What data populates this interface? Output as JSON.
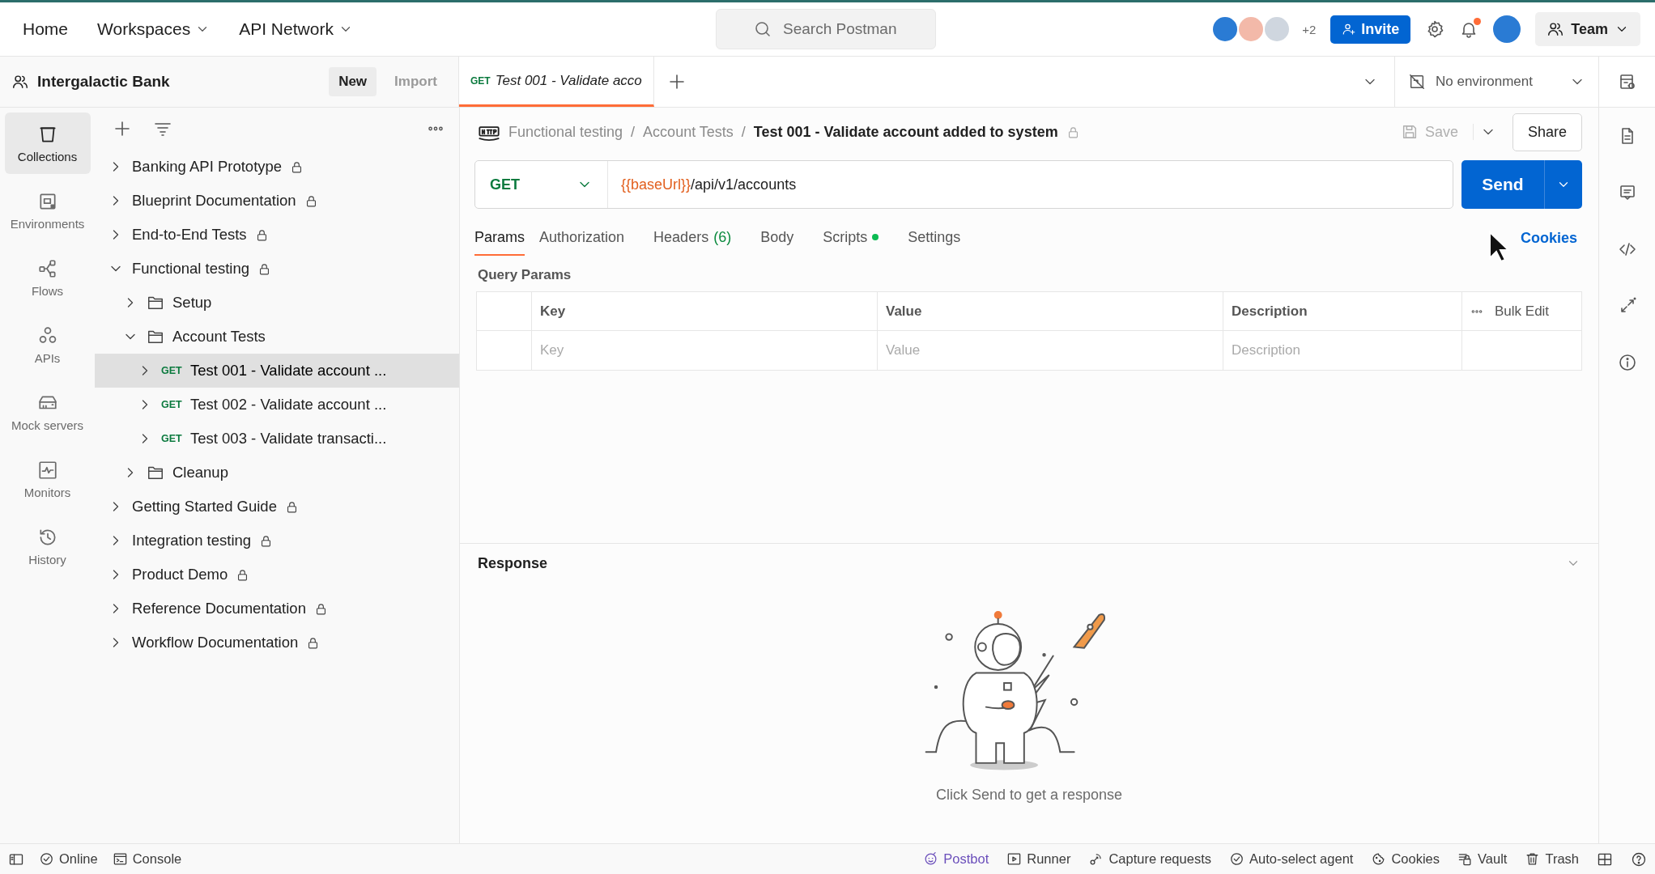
{
  "top_nav": [
    {
      "label": "Home",
      "has_menu": false
    },
    {
      "label": "Workspaces",
      "has_menu": true
    },
    {
      "label": "API Network",
      "has_menu": true
    }
  ],
  "search": {
    "placeholder": "Search Postman"
  },
  "collaborators": {
    "extra_count": "+2"
  },
  "invite": "Invite",
  "notifications": {
    "unread": true
  },
  "team": "Team",
  "workspace": {
    "name": "Intergalactic Bank",
    "buttons": [
      "New",
      "Import"
    ]
  },
  "tabs": [
    {
      "method": "GET",
      "title": "Test 001 - Validate acco",
      "selected": true,
      "preview": true
    }
  ],
  "environment": "No environment",
  "nav_rail": [
    {
      "label": "Collections",
      "selected": true
    },
    {
      "label": "Environments",
      "selected": false
    },
    {
      "label": "Flows",
      "selected": false
    },
    {
      "label": "APIs",
      "selected": false
    },
    {
      "label": "Mock servers",
      "selected": false
    },
    {
      "label": "Monitors",
      "selected": false
    },
    {
      "label": "History",
      "selected": false
    }
  ],
  "tree": [
    {
      "kind": "collection",
      "label": "Banking API Prototype",
      "expanded": false,
      "locked": true,
      "selected": false
    },
    {
      "kind": "collection",
      "label": "Blueprint Documentation",
      "expanded": false,
      "locked": true,
      "selected": false
    },
    {
      "kind": "collection",
      "label": "End-to-End Tests",
      "expanded": false,
      "locked": true,
      "selected": false
    },
    {
      "kind": "collection",
      "label": "Functional testing",
      "expanded": true,
      "locked": true,
      "selected": false,
      "children": [
        {
          "kind": "folder",
          "label": "Setup",
          "expanded": false,
          "locked": false,
          "selected": false
        },
        {
          "kind": "folder",
          "label": "Account Tests",
          "expanded": true,
          "locked": false,
          "selected": false,
          "children": [
            {
              "kind": "request",
              "method": "GET",
              "label": "Test 001 - Validate account ...",
              "expanded": false,
              "locked": false,
              "selected": true
            },
            {
              "kind": "request",
              "method": "GET",
              "label": "Test 002 - Validate account ...",
              "expanded": false,
              "locked": false,
              "selected": false
            },
            {
              "kind": "request",
              "method": "GET",
              "label": "Test 003 - Validate transacti...",
              "expanded": false,
              "locked": false,
              "selected": false
            }
          ]
        },
        {
          "kind": "folder",
          "label": "Cleanup",
          "expanded": false,
          "locked": false,
          "selected": false
        }
      ]
    },
    {
      "kind": "collection",
      "label": "Getting Started Guide",
      "expanded": false,
      "locked": true,
      "selected": false
    },
    {
      "kind": "collection",
      "label": "Integration testing",
      "expanded": false,
      "locked": true,
      "selected": false
    },
    {
      "kind": "collection",
      "label": "Product Demo",
      "expanded": false,
      "locked": true,
      "selected": false
    },
    {
      "kind": "collection",
      "label": "Reference Documentation",
      "expanded": false,
      "locked": true,
      "selected": false
    },
    {
      "kind": "collection",
      "label": "Workflow Documentation",
      "expanded": false,
      "locked": true,
      "selected": false
    }
  ],
  "breadcrumb": {
    "items": [
      "Functional testing",
      "Account Tests"
    ],
    "separator": "/"
  },
  "request_title": "Test 001 - Validate account added to system",
  "request_locked": true,
  "save": "Save",
  "share": "Share",
  "request": {
    "method": "GET",
    "url_variable": "{{baseUrl}}",
    "url_path": "/api/v1/accounts",
    "send": "Send"
  },
  "request_tabs": [
    {
      "label": "Params",
      "selected": true
    },
    {
      "label": "Authorization",
      "selected": false
    },
    {
      "label": "Headers",
      "count": "(6)",
      "selected": false
    },
    {
      "label": "Body",
      "selected": false
    },
    {
      "label": "Scripts",
      "indicator": true,
      "selected": false
    },
    {
      "label": "Settings",
      "selected": false
    }
  ],
  "cookies_link": "Cookies",
  "query_params": {
    "title": "Query Params",
    "columns": [
      "Key",
      "Value",
      "Description"
    ],
    "bulk_edit": "Bulk Edit",
    "placeholders": [
      "Key",
      "Value",
      "Description"
    ]
  },
  "response": {
    "title": "Response",
    "message": "Click Send to get a response"
  },
  "status_left": [
    "Online",
    "Console"
  ],
  "status_right": [
    {
      "label": "Postbot",
      "color": "#6b4fbb"
    },
    {
      "label": "Runner",
      "color": "#3b3b3b"
    },
    {
      "label": "Capture requests",
      "color": "#3b3b3b"
    },
    {
      "label": "Auto-select agent",
      "color": "#3b3b3b"
    },
    {
      "label": "Cookies",
      "color": "#3b3b3b"
    },
    {
      "label": "Vault",
      "color": "#3b3b3b"
    },
    {
      "label": "Trash",
      "color": "#3b3b3b"
    }
  ]
}
